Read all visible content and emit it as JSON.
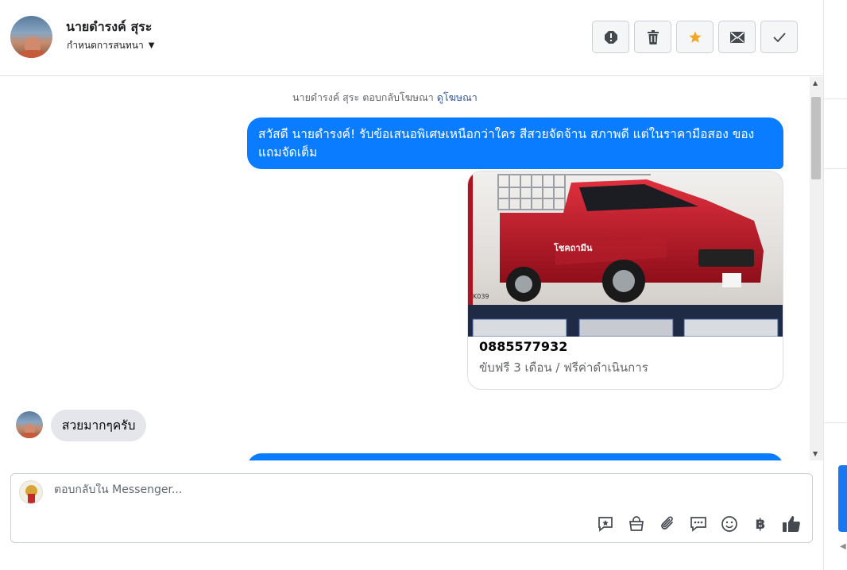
{
  "contact": {
    "name": "นายดำรงค์ สุระ",
    "assign_label": "กำหนดการสนทนา"
  },
  "header_actions": [
    {
      "icon": "alert-icon",
      "color": "#444950"
    },
    {
      "icon": "trash-icon",
      "color": "#444950"
    },
    {
      "icon": "star-icon",
      "color": "#f5a623"
    },
    {
      "icon": "envelope-icon",
      "color": "#444950"
    },
    {
      "icon": "check-icon",
      "color": "#444950"
    }
  ],
  "conversation": {
    "ad_notice": "นายดำรงค์ สุระ ตอบกลับโฆษณา",
    "ad_link": "ดูโฆษณา",
    "outgoing_message": "สวัสดี นายดำรงค์! รับข้อเสนอพิเศษเหนือกว่าใคร สีสวยจัดจ้าน สภาพดี แต่ในราคามือสอง ของแถมจัดเต็ม",
    "ad_card": {
      "image": "red-pickup-truck-with-cargo-rack",
      "phone": "0885577932",
      "subtitle": "ขับฟรี 3 เดือน / ฟรีค่าดำเนินการ",
      "image_caption": "K039"
    },
    "incoming_message": "สวยมากๆครับ"
  },
  "composer": {
    "placeholder": "ตอบกลับใน Messenger...",
    "tools": [
      "saved-reply-icon",
      "shop-bag-icon",
      "paperclip-icon",
      "chat-bubbles-icon",
      "emoji-icon",
      "baht-icon",
      "thumbs-up-icon"
    ],
    "baht_symbol": "฿"
  },
  "colors": {
    "accent_blue": "#0a7cff",
    "star_orange": "#f5a623",
    "incoming_bubble": "#e4e6eb"
  }
}
